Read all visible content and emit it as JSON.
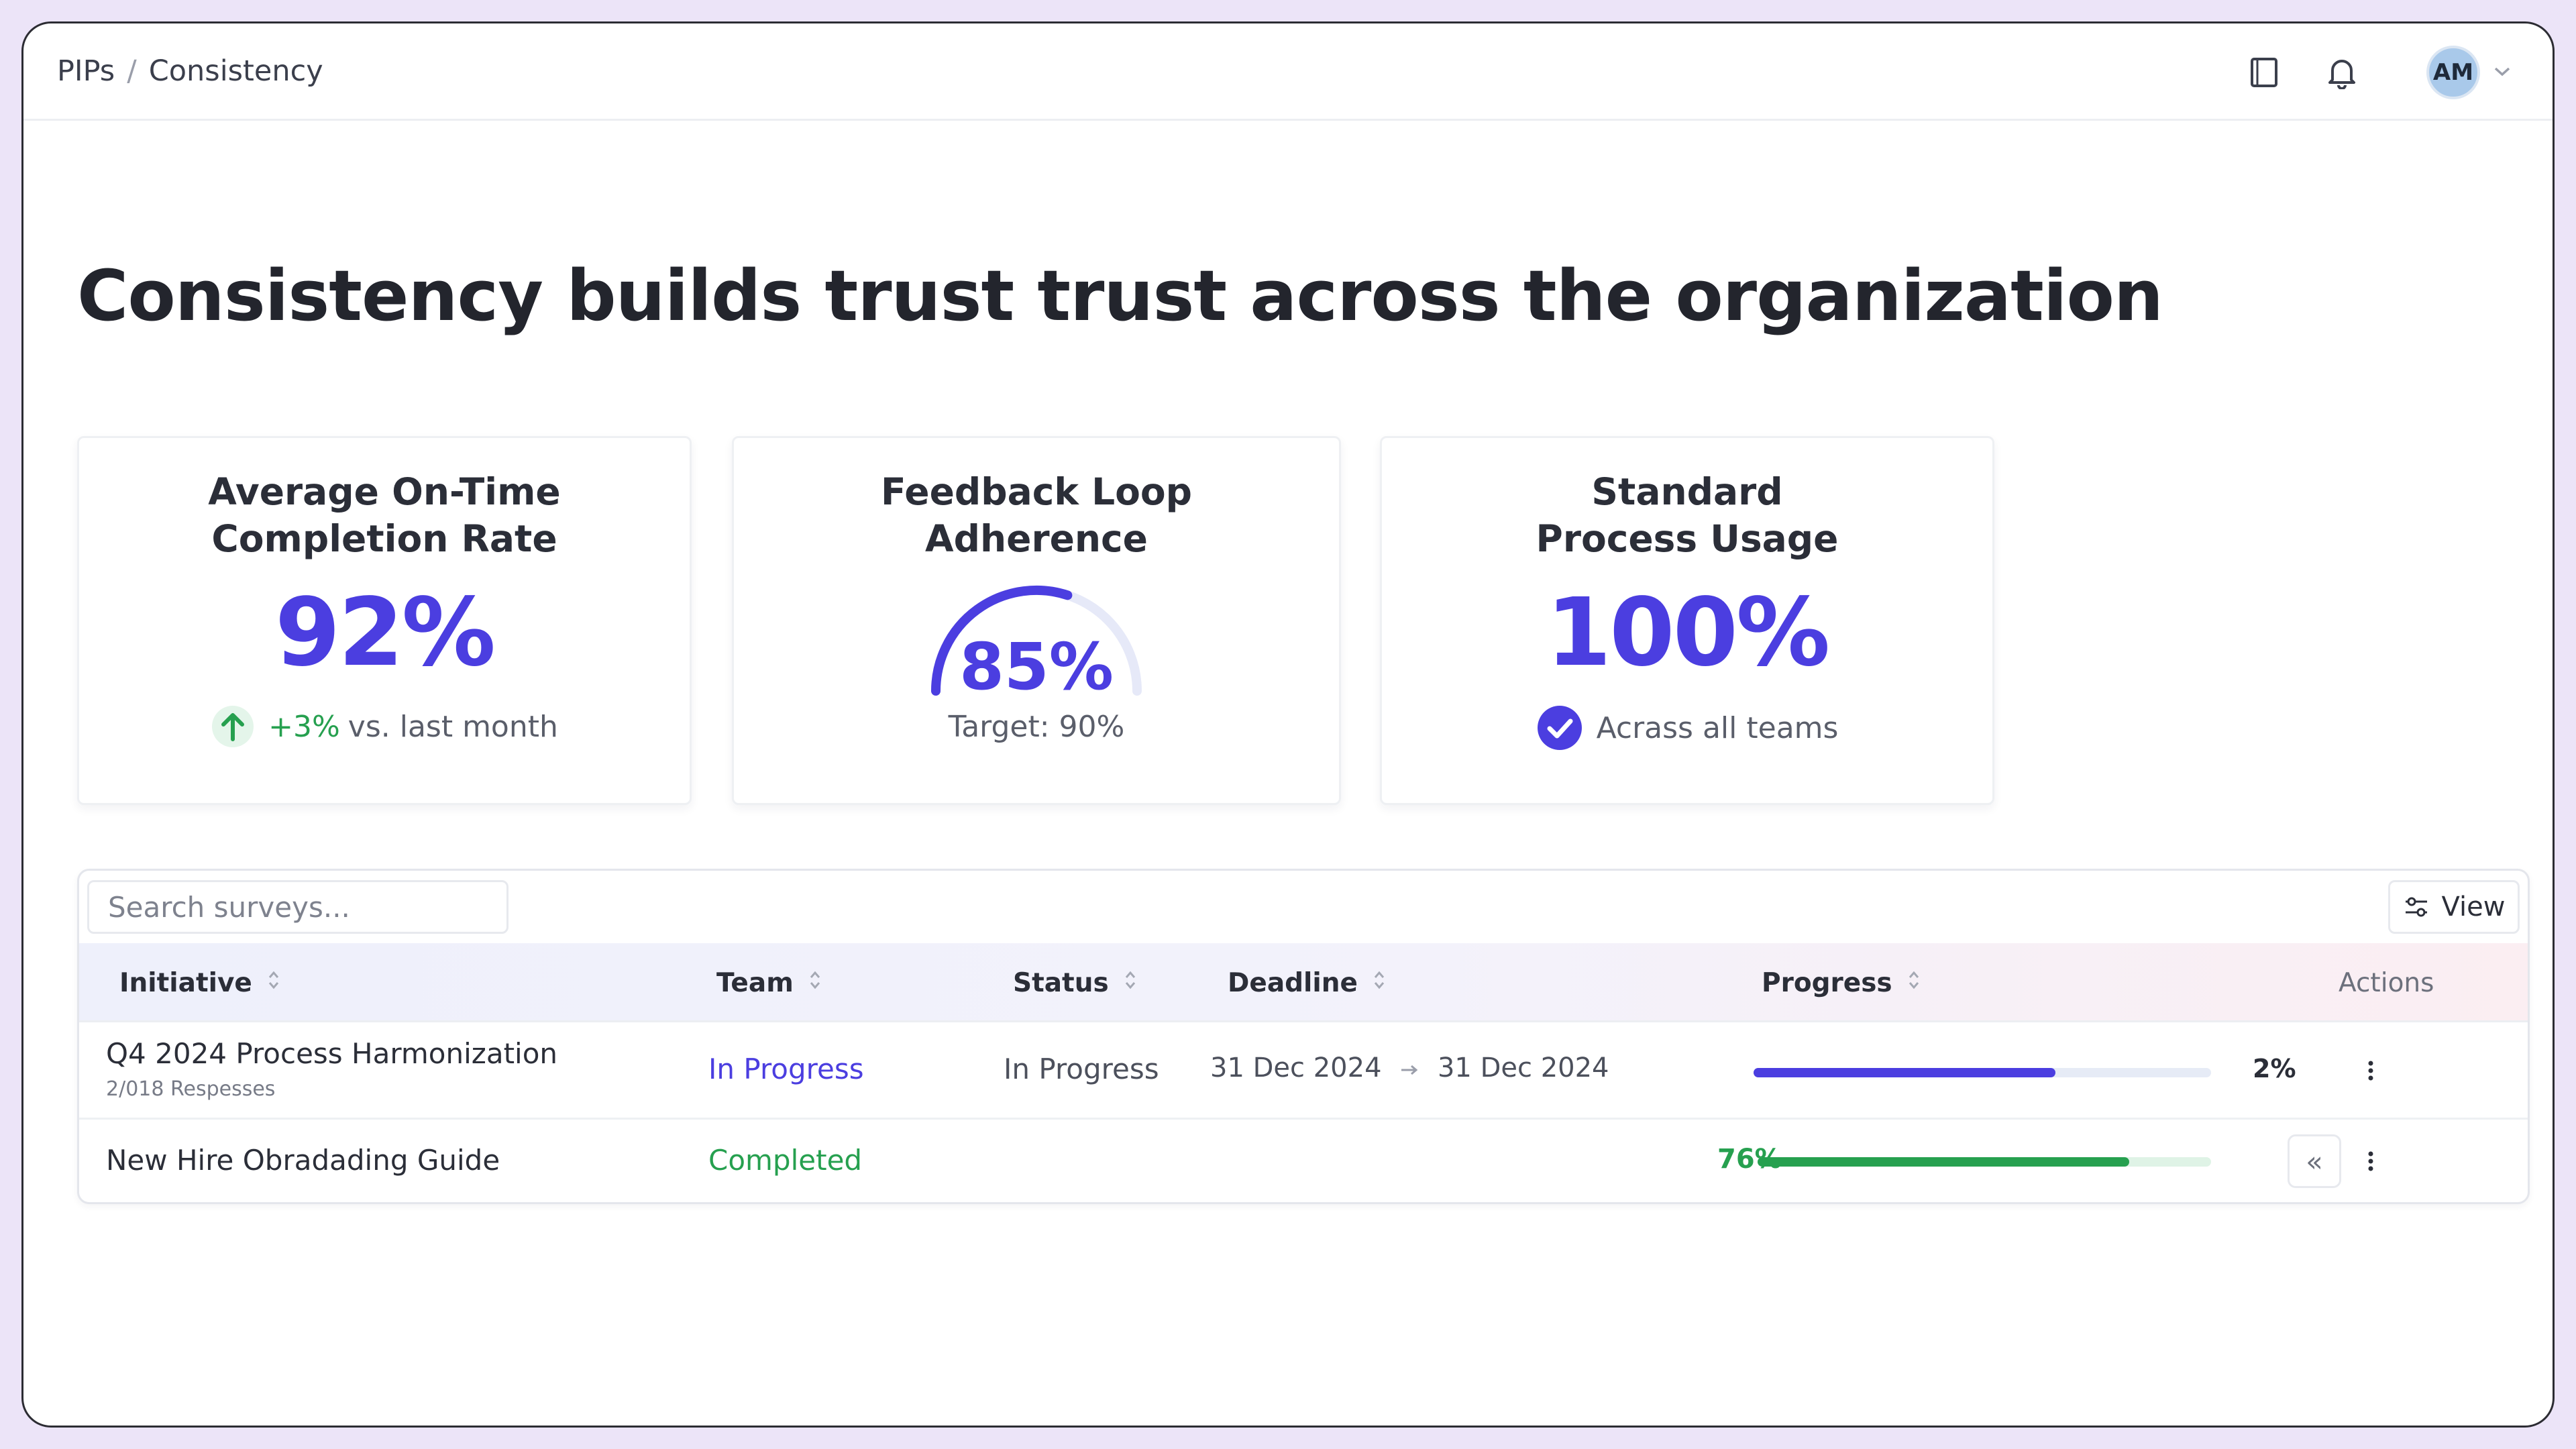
{
  "breadcrumb": {
    "root": "PIPs",
    "separator": "/",
    "current": "Consistency"
  },
  "header": {
    "avatar_initials": "AM",
    "icons": [
      "book-icon",
      "bell-icon",
      "chevron-down-icon"
    ]
  },
  "page_title": "Consistency builds trust trust across the organization",
  "cards": {
    "on_time": {
      "title_line1": "Average On-Time",
      "title_line2": "Completion Rate",
      "value": "92%",
      "delta": "+3%",
      "delta_suffix": "vs. last month"
    },
    "feedback": {
      "title_line1": "Feedback Loop",
      "title_line2": "Adherence",
      "value": "85%",
      "gauge_fraction": 0.6,
      "target": "Target: 90%"
    },
    "standard": {
      "title_line1": "Standard",
      "title_line2": "Process Usage",
      "value": "100%",
      "sub": "Acrass all teams"
    }
  },
  "table": {
    "search_placeholder": "Search surveys...",
    "view_label": "View",
    "columns": {
      "initiative": "Initiative",
      "team": "Team",
      "status": "Status",
      "deadline": "Deadline",
      "progress": "Progress",
      "actions": "Actions"
    },
    "rows": [
      {
        "initiative": "Q4 2024 Process Harmonization",
        "responses": "2/018 Respesses",
        "team": "In Progress",
        "status": "In Progress",
        "deadline_start": "31 Dec 2024",
        "deadline_end": "31 Dec 2024",
        "progress_label": "2%",
        "progress_fill": 0.66,
        "color": "#4b3ee0"
      },
      {
        "initiative": "New Hire Obradading Guide",
        "team": "Completed",
        "progress_label": "76%",
        "progress_fill": 0.82,
        "color": "#26a04f"
      }
    ]
  },
  "colors": {
    "accent": "#4b3ee0",
    "success": "#26a04f",
    "background": "#ece4f8"
  }
}
